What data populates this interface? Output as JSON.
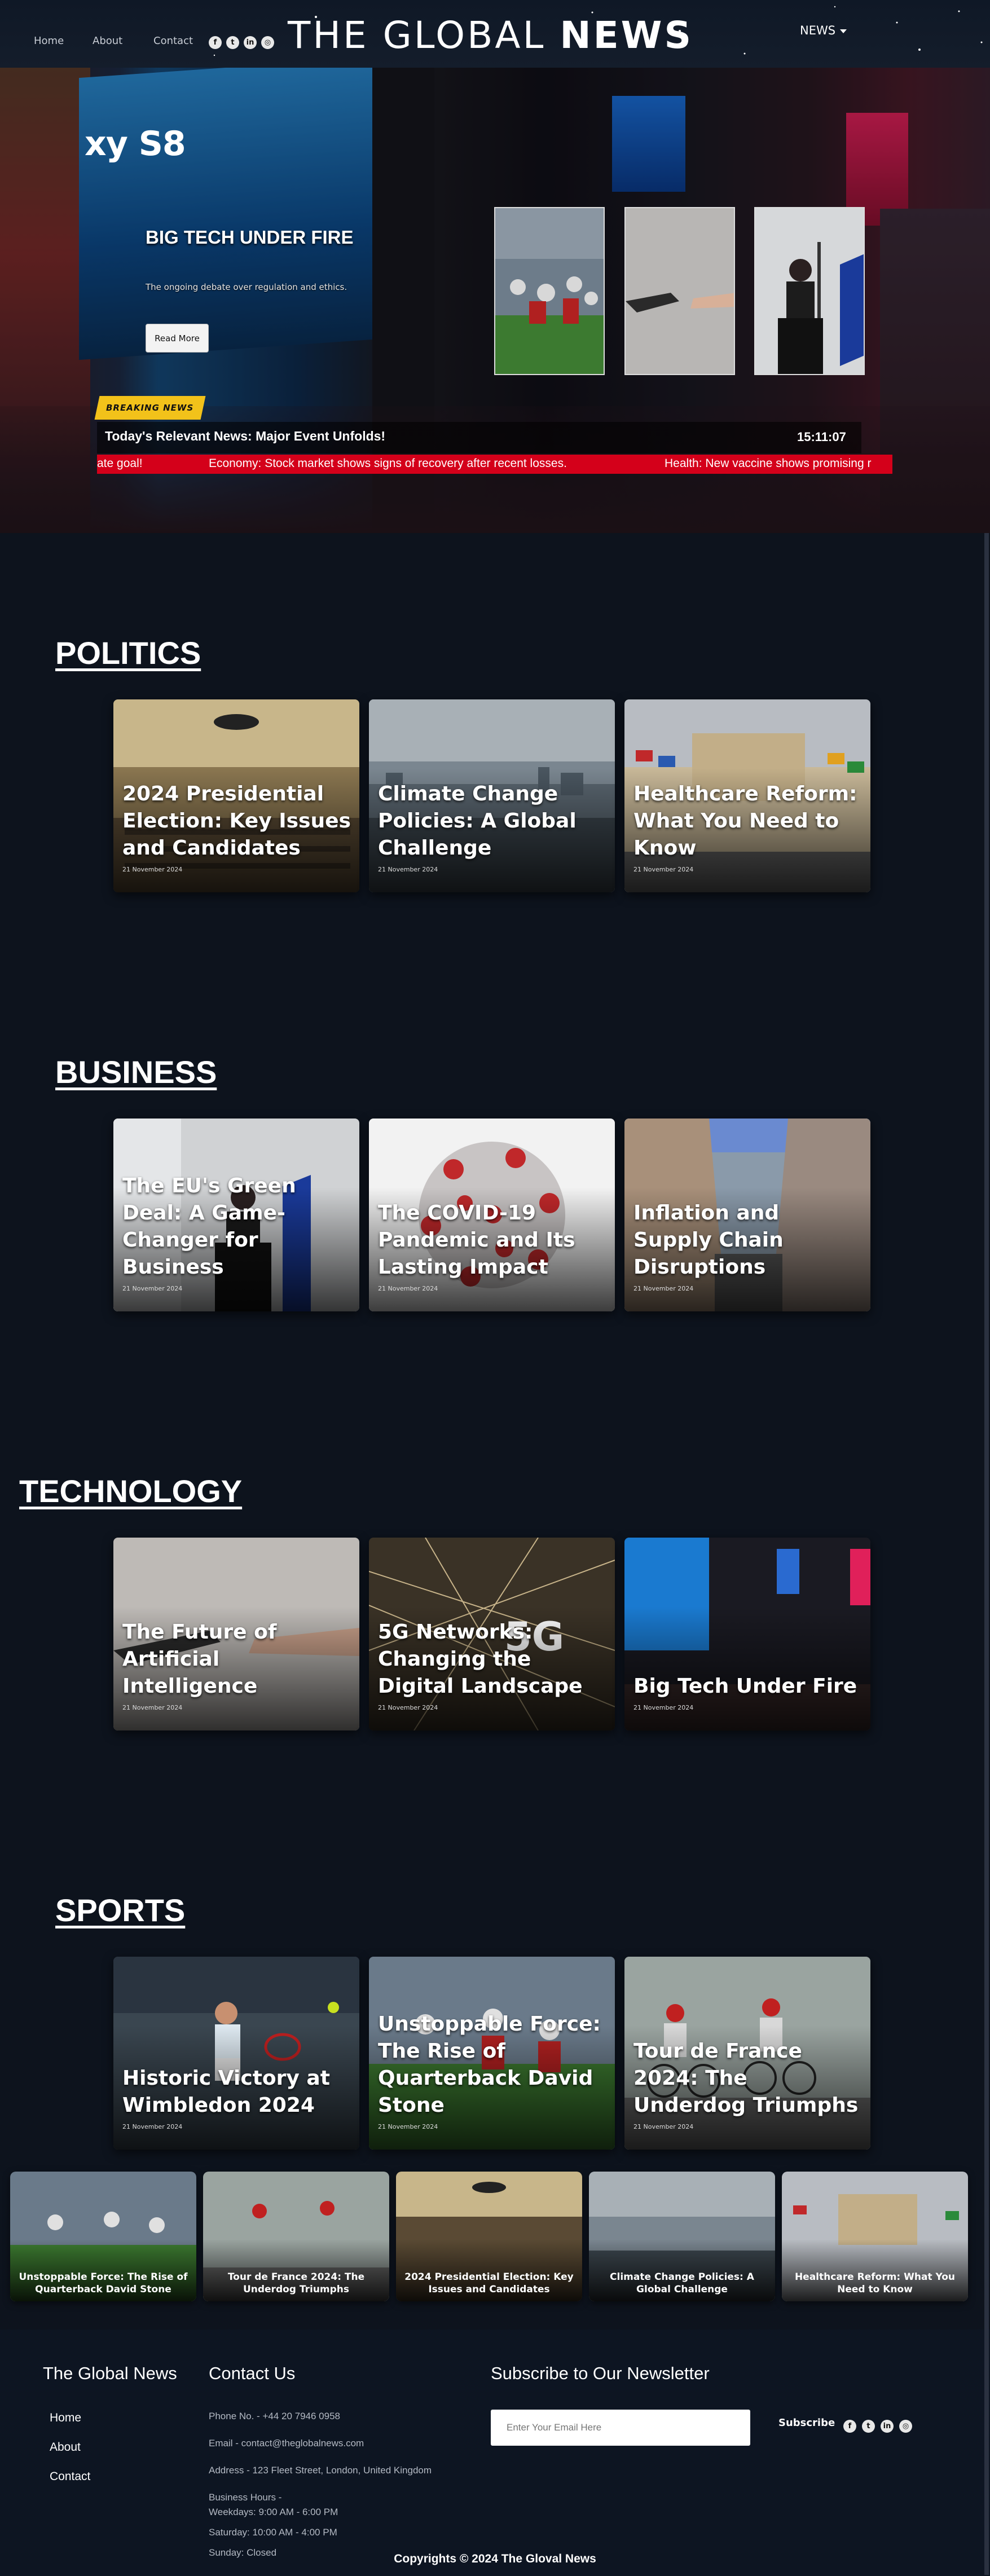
{
  "nav": {
    "links": [
      "Home",
      "About",
      "Contact"
    ],
    "social_icons": [
      "facebook-icon",
      "twitter-icon",
      "linkedin-icon",
      "instagram-icon"
    ],
    "brand_light": "THE GLOBAL ",
    "brand_bold": "NEWS",
    "dropdown_label": "NEWS"
  },
  "hero": {
    "title": "BIG TECH UNDER FIRE",
    "description": "The ongoing debate over regulation and ethics.",
    "button_label": "Read More",
    "billboard_text": "xy S8",
    "breaking_label": "BREAKING NEWS",
    "headline": "Today's Relevant News: Major Event Unfolds!",
    "clock": "15:11:07",
    "ticker": [
      "ate goal!",
      "Economy: Stock market shows signs of recovery after recent losses.",
      "Health: New vaccine shows promising r"
    ]
  },
  "sections": [
    {
      "title": "POLITICS",
      "cards": [
        {
          "title": "2024 Presidential Election: Key Issues and Candidates",
          "date": "21 November 2024"
        },
        {
          "title": "Climate Change Policies: A Global Challenge",
          "date": "21 November 2024"
        },
        {
          "title": "Healthcare Reform: What You Need to Know",
          "date": "21 November 2024"
        }
      ]
    },
    {
      "title": "BUSINESS",
      "cards": [
        {
          "title": "The EU's Green Deal: A Game-Changer for Business",
          "date": "21 November 2024"
        },
        {
          "title": "The COVID-19 Pandemic and Its Lasting Impact",
          "date": "21 November 2024"
        },
        {
          "title": "Inflation and Supply Chain Disruptions",
          "date": "21 November 2024"
        }
      ]
    },
    {
      "title": "TECHNOLOGY",
      "cards": [
        {
          "title": "The Future of Artificial Intelligence",
          "date": "21 November 2024"
        },
        {
          "title": "5G Networks: Changing the Digital Landscape",
          "date": "21 November 2024"
        },
        {
          "title": "Big Tech Under Fire",
          "date": "21 November 2024"
        }
      ]
    },
    {
      "title": "SPORTS",
      "cards": [
        {
          "title": "Historic Victory at Wimbledon 2024",
          "date": "21 November 2024"
        },
        {
          "title": "Unstoppable Force: The Rise of Quarterback David Stone",
          "date": "21 November 2024"
        },
        {
          "title": "Tour de France 2024: The Underdog Triumphs",
          "date": "21 November 2024"
        }
      ]
    }
  ],
  "slider": [
    "Unstoppable Force: The Rise of Quarterback David Stone",
    "Tour de France 2024: The Underdog Triumphs",
    "2024 Presidential Election: Key Issues and Candidates",
    "Climate Change Policies: A Global Challenge",
    "Healthcare Reform: What You Need to Know"
  ],
  "footer": {
    "brand": "The Global News",
    "links": [
      "Home",
      "About",
      "Contact"
    ],
    "contact_heading": "Contact Us",
    "phone": "Phone No. - +44 20 7946 0958",
    "email": "Email - contact@theglobalnews.com",
    "address": "Address - 123 Fleet Street, London, United Kingdom",
    "hours_heading": "Business Hours -",
    "hours": [
      "Weekdays: 9:00 AM - 6:00 PM",
      "Saturday: 10:00 AM - 4:00 PM",
      "Sunday: Closed"
    ],
    "newsletter_heading": "Subscribe to Our Newsletter",
    "email_placeholder": "Enter Your Email Here",
    "subscribe_label": "Subscribe",
    "social_icons": [
      "facebook-icon",
      "twitter-icon",
      "linkedin-icon",
      "instagram-icon"
    ],
    "copyright": "Copyrights © 2024 The Gloval News"
  },
  "colors": {
    "page_bg": "#0d131d",
    "ticker_red": "#d4001a",
    "breaking_yellow": "#f2c21a"
  }
}
